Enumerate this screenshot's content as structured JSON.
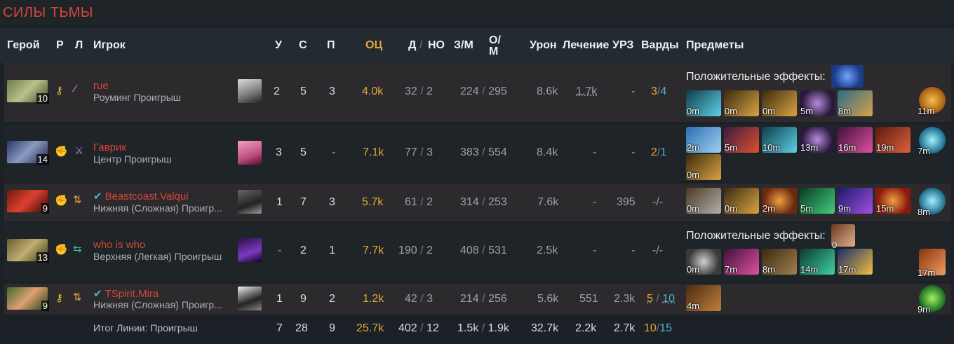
{
  "title": "СИЛЫ ТЬМЫ",
  "headers": {
    "hero": "Герой",
    "role": "Р",
    "lane": "Л",
    "player": "Игрок",
    "kills": "У",
    "deaths": "С",
    "assists": "П",
    "net": "ОЦ",
    "dn": "Д",
    "slash": "/",
    "denies": "НО",
    "gpm": "З/М",
    "xpm_top": "О/",
    "xpm_bottom": "М",
    "damage": "Урон",
    "heal": "Лечение",
    "building": "УРЗ",
    "wards": "Варды",
    "items": "Предметы"
  },
  "buff_label": "Положительные эффекты:",
  "rows": [
    {
      "level": "10",
      "name": "rue",
      "sub": "Роуминг Проигрыш",
      "verified": false,
      "role_icon": "key-icon",
      "lane_icon": "sword-dots-icon",
      "k": "2",
      "d": "5",
      "a": "3",
      "net": "4.0k",
      "lh": "32",
      "dn": "2",
      "gpm": "224",
      "xpm": "295",
      "dmg": "8.6k",
      "heal": "1.7k",
      "bld": "-",
      "w1": "3",
      "w2": "4",
      "buff_time": "",
      "items": [
        {
          "t": "0m"
        },
        {
          "t": "0m"
        },
        {
          "t": "0m"
        },
        {
          "t": "5m"
        },
        {
          "t": "8m"
        }
      ],
      "neutral": "11m"
    },
    {
      "level": "14",
      "name": "Гаврик",
      "sub": "Центр Проигрыш",
      "verified": false,
      "role_icon": "fist-icon",
      "lane_icon": "sword-icon",
      "k": "3",
      "d": "5",
      "a": "-",
      "net": "7.1k",
      "lh": "77",
      "dn": "3",
      "gpm": "383",
      "xpm": "554",
      "dmg": "8.4k",
      "heal": "-",
      "bld": "-",
      "w1": "2",
      "w2": "1",
      "items": [
        {
          "t": "2m"
        },
        {
          "t": "5m"
        },
        {
          "t": "10m"
        },
        {
          "t": "13m"
        },
        {
          "t": "16m"
        },
        {
          "t": "19m"
        },
        {
          "t": "0m"
        }
      ],
      "neutral": "7m"
    },
    {
      "level": "9",
      "name": "Beastcoast.Valqui",
      "sub": "Нижняя (Сложная) Проигр...",
      "verified": true,
      "role_icon": "fist-icon",
      "lane_icon": "arrows-icon",
      "k": "1",
      "d": "7",
      "a": "3",
      "net": "5.7k",
      "lh": "61",
      "dn": "2",
      "gpm": "314",
      "xpm": "253",
      "dmg": "7.6k",
      "heal": "-",
      "bld": "395",
      "wards": "-/-",
      "items": [
        {
          "t": "0m"
        },
        {
          "t": "0m"
        },
        {
          "t": "2m"
        },
        {
          "t": "5m"
        },
        {
          "t": "9m"
        },
        {
          "t": "15m"
        }
      ],
      "neutral": "8m"
    },
    {
      "level": "13",
      "name": "who is who",
      "sub": "Верхняя (Легкая) Проигрыш",
      "verified": false,
      "role_icon": "fist-icon",
      "lane_icon": "swap-icon",
      "k": "-",
      "d": "2",
      "a": "1",
      "net": "7.7k",
      "lh": "190",
      "dn": "2",
      "gpm": "408",
      "xpm": "531",
      "dmg": "2.5k",
      "heal": "-",
      "bld": "-",
      "wards": "-/-",
      "buff_time": "0",
      "items": [
        {
          "t": "0m"
        },
        {
          "t": "7m"
        },
        {
          "t": "8m"
        },
        {
          "t": "14m"
        },
        {
          "t": "17m"
        }
      ],
      "neutral": "17m"
    },
    {
      "level": "9",
      "name": "TSpirit.Mira",
      "sub": "Нижняя (Сложная) Проигр...",
      "verified": true,
      "role_icon": "key-icon",
      "lane_icon": "arrows-icon",
      "k": "1",
      "d": "9",
      "a": "2",
      "net": "1.2k",
      "lh": "42",
      "dn": "3",
      "gpm": "214",
      "xpm": "256",
      "dmg": "5.6k",
      "heal": "551",
      "bld": "2.3k",
      "w1": "5",
      "w2": "10",
      "items": [
        {
          "t": "4m"
        }
      ],
      "neutral": "9m"
    }
  ],
  "totals": {
    "label": "Итог Линии: Проигрыш",
    "k": "7",
    "d": "28",
    "a": "9",
    "net": "25.7k",
    "lh": "402",
    "dn": "12",
    "gpm": "1.5k",
    "xpm": "1.9k",
    "dmg": "32.7k",
    "heal": "2.2k",
    "bld": "2.7k",
    "w1": "10",
    "w2": "15"
  }
}
